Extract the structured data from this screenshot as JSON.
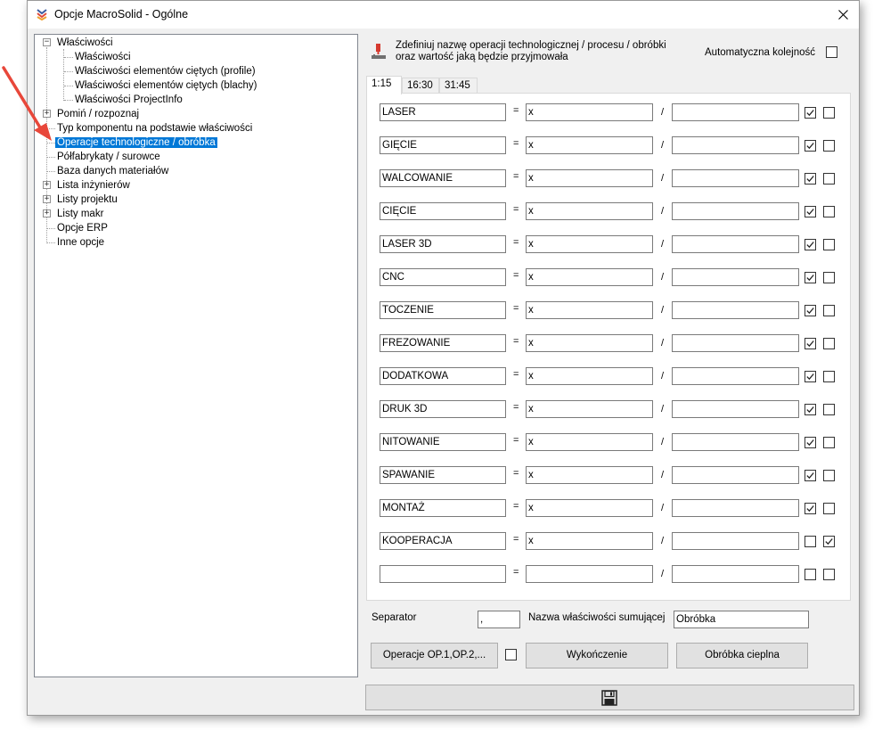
{
  "window": {
    "title": "Opcje MacroSolid - Ogólne"
  },
  "tree": {
    "items": [
      {
        "label": "Właściwości"
      },
      {
        "label": "Właściwości"
      },
      {
        "label": "Właściwości elementów ciętych (profile)"
      },
      {
        "label": "Właściwości elementów ciętych (blachy)"
      },
      {
        "label": "Właściwości ProjectInfo"
      },
      {
        "label": "Pomiń / rozpoznaj"
      },
      {
        "label": "Typ komponentu na podstawie właściwości"
      },
      {
        "label": "Operacje technologiczne / obróbka",
        "selected": true
      },
      {
        "label": "Półfabrykaty / surowce"
      },
      {
        "label": "Baza danych materiałów"
      },
      {
        "label": "Lista inżynierów"
      },
      {
        "label": "Listy projektu"
      },
      {
        "label": "Listy makr"
      },
      {
        "label": "Opcje ERP"
      },
      {
        "label": "Inne opcje"
      }
    ]
  },
  "header": {
    "line1": "Zdefiniuj nazwę operacji technologicznej / procesu / obróbki",
    "line2": "oraz wartość jaką będzie przyjmowała",
    "auto_order_label": "Automatyczna kolejność",
    "auto_order_checked": false
  },
  "tabs": [
    "1:15",
    "16:30",
    "31:45"
  ],
  "operations": {
    "equals_symbol": "=",
    "slash_symbol": "/",
    "rows": [
      {
        "name": "LASER",
        "value": "x",
        "extra": "",
        "checked1": true,
        "checked2": false
      },
      {
        "name": "GIĘCIE",
        "value": "x",
        "extra": "",
        "checked1": true,
        "checked2": false
      },
      {
        "name": "WALCOWANIE",
        "value": "x",
        "extra": "",
        "checked1": true,
        "checked2": false
      },
      {
        "name": "CIĘCIE",
        "value": "x",
        "extra": "",
        "checked1": true,
        "checked2": false
      },
      {
        "name": "LASER 3D",
        "value": "x",
        "extra": "",
        "checked1": true,
        "checked2": false
      },
      {
        "name": "CNC",
        "value": "x",
        "extra": "",
        "checked1": true,
        "checked2": false
      },
      {
        "name": "TOCZENIE",
        "value": "x",
        "extra": "",
        "checked1": true,
        "checked2": false
      },
      {
        "name": "FREZOWANIE",
        "value": "x",
        "extra": "",
        "checked1": true,
        "checked2": false
      },
      {
        "name": "DODATKOWA",
        "value": "x",
        "extra": "",
        "checked1": true,
        "checked2": false
      },
      {
        "name": "DRUK 3D",
        "value": "x",
        "extra": "",
        "checked1": true,
        "checked2": false
      },
      {
        "name": "NITOWANIE",
        "value": "x",
        "extra": "",
        "checked1": true,
        "checked2": false
      },
      {
        "name": "SPAWANIE",
        "value": "x",
        "extra": "",
        "checked1": true,
        "checked2": false
      },
      {
        "name": "MONTAŻ",
        "value": "x",
        "extra": "",
        "checked1": true,
        "checked2": false
      },
      {
        "name": "KOOPERACJA",
        "value": "x",
        "extra": "",
        "checked1": false,
        "checked2": true
      },
      {
        "name": "",
        "value": "",
        "extra": "",
        "checked1": false,
        "checked2": false
      }
    ]
  },
  "footer": {
    "separator_label": "Separator",
    "separator_value": ",",
    "sum_label": "Nazwa właściwości sumującej",
    "sum_value": "Obróbka",
    "op_button": "Operacje OP.1,OP.2,...",
    "op_checked": false,
    "finish_button": "Wykończenie",
    "heat_button": "Obróbka cieplna"
  },
  "colors": {
    "selection": "#0078d7",
    "arrow": "#e8473a"
  },
  "icons": [
    "app-logo-icon",
    "close-icon",
    "operation-tool-icon",
    "save-icon",
    "checkmark-icon"
  ]
}
